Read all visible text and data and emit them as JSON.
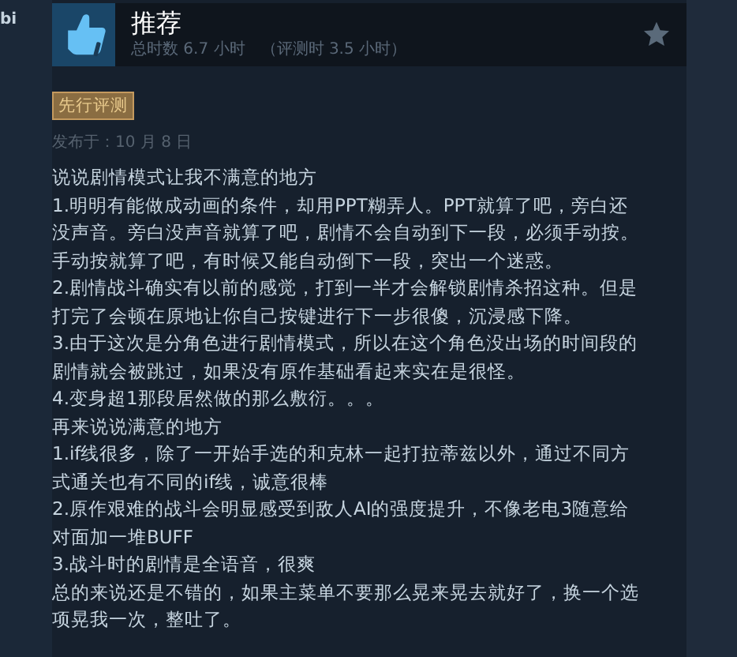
{
  "author": {
    "name": "bi"
  },
  "review": {
    "verdict": "推荐",
    "recommended": true,
    "hours": "总时数 6.7 小时",
    "hours_at_review": "（评测时 3.5 小时）",
    "badge": "先行评测",
    "posted": "发布于：10 月 8 日",
    "paragraphs": [
      "说说剧情模式让我不满意的地方",
      "1.明明有能做成动画的条件，却用PPT糊弄人。PPT就算了吧，旁白还没声音。旁白没声音就算了吧，剧情不会自动到下一段，必须手动按。手动按就算了吧，有时候又能自动倒下一段，突出一个迷惑。",
      "2.剧情战斗确实有以前的感觉，打到一半才会解锁剧情杀招这种。但是打完了会顿在原地让你自己按键进行下一步很傻，沉浸感下降。",
      "3.由于这次是分角色进行剧情模式，所以在这个角色没出场的时间段的剧情就会被跳过，如果没有原作基础看起来实在是很怪。",
      "4.变身超1那段居然做的那么敷衍。。。",
      "再来说说满意的地方",
      "1.if线很多，除了一开始手选的和克林一起打拉蒂兹以外，通过不同方式通关也有不同的if线，诚意很棒",
      "2.原作艰难的战斗会明显感受到敌人AI的强度提升，不像老电3随意给对面加一堆BUFF",
      "3.战斗时的剧情是全语音，很爽",
      "总的来说还是不错的，如果主菜单不要那么晃来晃去就好了，换一个选项晃我一次，整吐了。"
    ]
  }
}
